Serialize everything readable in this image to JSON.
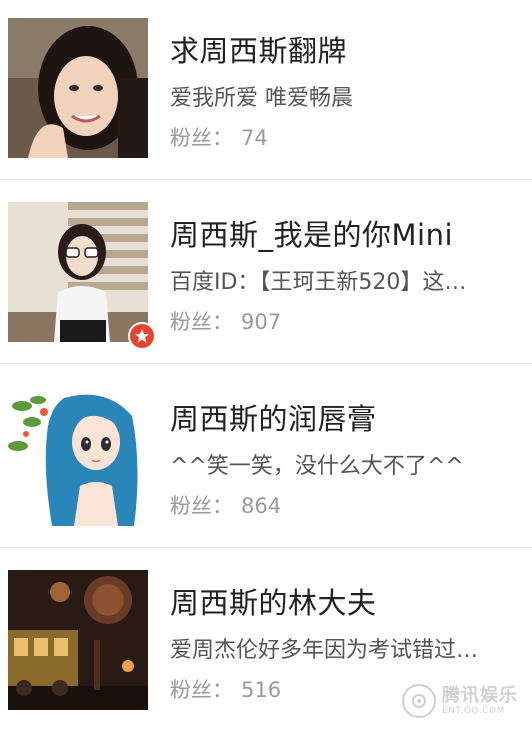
{
  "results": [
    {
      "name": "求周西斯翻牌",
      "description": "爱我所爱 唯爱畅晨",
      "fans_label": "粉丝",
      "fans_sep": "：",
      "fans_count": "74",
      "avatar_icon": "portrait-smiling-woman",
      "verified": false
    },
    {
      "name": "周西斯_我是的你Mini",
      "description": "百度ID：【王珂王新520】这…",
      "fans_label": "粉丝",
      "fans_sep": "：",
      "fans_count": "907",
      "avatar_icon": "portrait-girl-sunglasses",
      "verified": true
    },
    {
      "name": "周西斯的润唇膏",
      "description": "^^笑一笑，没什么大不了^^",
      "fans_label": "粉丝",
      "fans_sep": "：",
      "fans_count": "864",
      "avatar_icon": "anime-girl-blue-hair",
      "verified": false
    },
    {
      "name": "周西斯的林大夫",
      "description": "爱周杰伦好多年因为考试错过…",
      "fans_label": "粉丝",
      "fans_sep": "：",
      "fans_count": "516",
      "avatar_icon": "steampunk-train-scene",
      "verified": false
    }
  ],
  "watermark": {
    "main": "腾讯娱乐",
    "sub": "ENT.QQ.COM"
  },
  "colors": {
    "name_text": "#222222",
    "desc_text": "#555555",
    "fans_text": "#9a9a9a",
    "divider": "#e1e1e1",
    "badge": "#e5432c"
  }
}
